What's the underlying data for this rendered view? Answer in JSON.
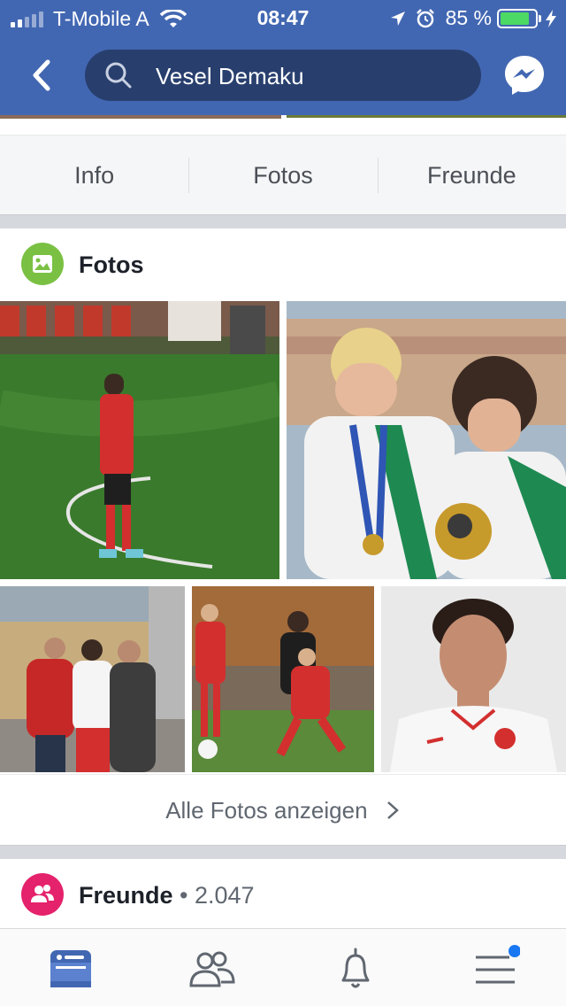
{
  "status_bar": {
    "carrier": "T-Mobile A",
    "time": "08:47",
    "battery_percent": "85 %",
    "battery_level": 0.85
  },
  "nav": {
    "back_icon": "back-chevron-icon",
    "search_query": "Vesel Demaku",
    "messenger_icon": "messenger-icon"
  },
  "profile_tabs": [
    "Info",
    "Fotos",
    "Freunde"
  ],
  "photos_section": {
    "title": "Fotos",
    "icon": "photo-icon",
    "icon_color": "#7ac143",
    "show_all_label": "Alle Fotos anzeigen"
  },
  "friends_section": {
    "title": "Freunde",
    "separator": "•",
    "count": "2.047",
    "icon": "friends-icon",
    "icon_color": "#e5226c"
  },
  "tab_bar": {
    "items": [
      "news-feed-icon",
      "friend-requests-icon",
      "notifications-bell-icon",
      "menu-icon"
    ],
    "active_color": "#4267b2",
    "badge_color": "#1877f2"
  },
  "colors": {
    "brand": "#4267b2",
    "search_bg": "#283f6e",
    "battery": "#4cd964"
  }
}
